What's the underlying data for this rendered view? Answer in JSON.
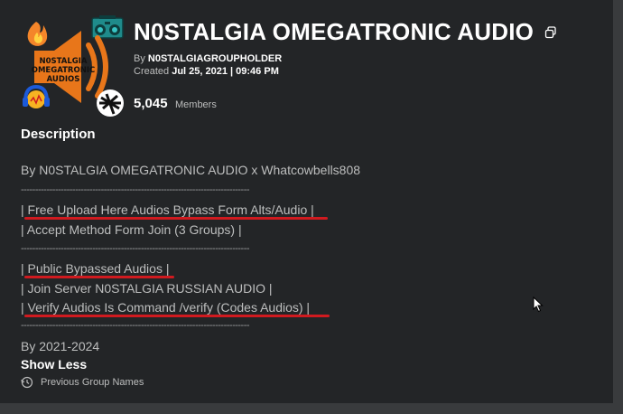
{
  "group": {
    "name": "N0STALGIA OMEGATRONIC AUDIO",
    "logo_text": [
      "N0STALGIA",
      "OMEGATRONIC",
      "AUDIOS"
    ],
    "by_label": "By",
    "owner": "N0STALGIAGROUPHOLDER",
    "created_label": "Created",
    "created_date": "Jul 25, 2021 | 09:46 PM",
    "member_count": "5,045",
    "member_label": "Members"
  },
  "description": {
    "heading": "Description",
    "lines": [
      "By N0STALGIA OMEGATRONIC AUDIO x Whatcowbells808",
      "--------------------------------------------------------------------------------",
      "| Free Upload Here Audios Bypass Form Alts/Audio |",
      "| Accept Method Form Join (3 Groups) |",
      "--------------------------------------------------------------------------------",
      "| Public Bypassed Audios |",
      "| Join Server N0STALGIA RUSSIAN AUDIO |",
      "| Verify Audios Is Command /verify (Codes Audios) |",
      "--------------------------------------------------------------------------------",
      "By 2021-2024"
    ]
  },
  "actions": {
    "show_less": "Show Less",
    "previous_names": "Previous Group Names"
  },
  "colors": {
    "panel": "#232527",
    "background": "#393b3d",
    "underline": "#d01a1f",
    "title": "#ffffff"
  }
}
